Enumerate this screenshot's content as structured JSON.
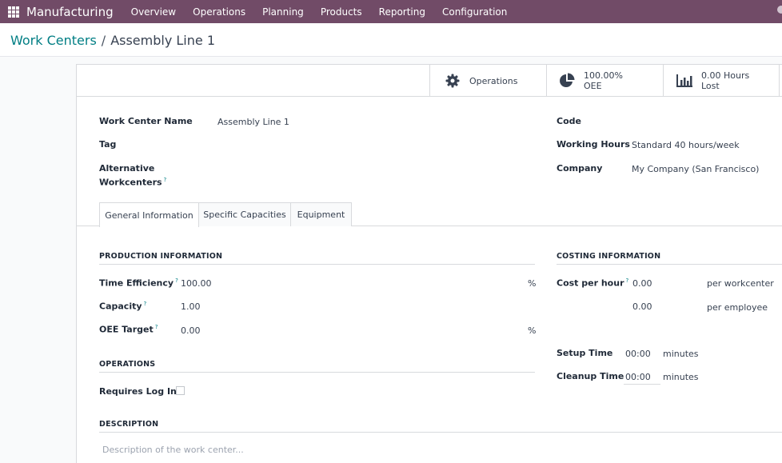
{
  "navbar": {
    "app_name": "Manufacturing",
    "menu": [
      "Overview",
      "Operations",
      "Planning",
      "Products",
      "Reporting",
      "Configuration"
    ]
  },
  "breadcrumb": {
    "parent": "Work Centers",
    "separator": "/",
    "current": "Assembly Line 1"
  },
  "stat_buttons": {
    "operations": "Operations",
    "oee_value": "100.00%",
    "oee_label": "OEE",
    "lost_value": "0.00 Hours",
    "lost_label": "Lost"
  },
  "form": {
    "name_label": "Work Center Name",
    "name_value": "Assembly Line 1",
    "tag_label": "Tag",
    "alt_label_1": "Alternative",
    "alt_label_2": "Workcenters",
    "help_mark": "?",
    "code_label": "Code",
    "working_hours_label": "Working Hours",
    "working_hours_value": "Standard 40 hours/week",
    "company_label": "Company",
    "company_value": "My Company (San Francisco)"
  },
  "tabs": [
    "General Information",
    "Specific Capacities",
    "Equipment"
  ],
  "production": {
    "title": "PRODUCTION INFORMATION",
    "time_eff_label": "Time Efficiency",
    "time_eff_value": "100.00",
    "capacity_label": "Capacity",
    "capacity_value": "1.00",
    "oee_target_label": "OEE Target",
    "oee_target_value": "0.00",
    "percent": "%"
  },
  "operations": {
    "title": "OPERATIONS",
    "requires_login_label": "Requires Log In"
  },
  "description": {
    "title": "DESCRIPTION",
    "placeholder": "Description of the work center..."
  },
  "costing": {
    "title": "COSTING INFORMATION",
    "cost_label": "Cost per hour",
    "cost_wc_value": "0.00",
    "cost_wc_unit": "per workcenter",
    "cost_emp_value": "0.00",
    "cost_emp_unit": "per employee",
    "setup_label": "Setup Time",
    "setup_value": "00:00",
    "cleanup_label": "Cleanup Time",
    "cleanup_value": "00:00",
    "minutes": "minutes"
  },
  "colors": {
    "navbar": "#714b67",
    "link": "#017e84"
  }
}
